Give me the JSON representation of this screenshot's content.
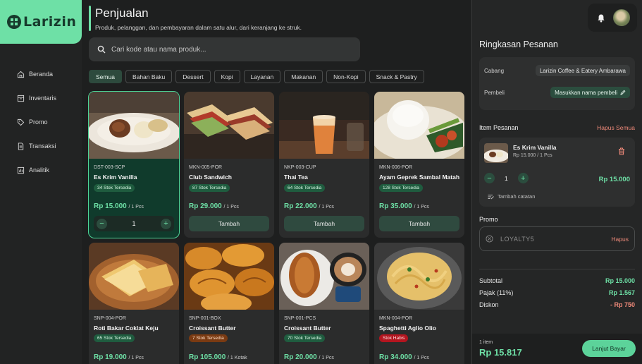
{
  "brand": {
    "name": "Larizin"
  },
  "sidebar": {
    "items": [
      {
        "label": "Beranda",
        "icon": "home-icon"
      },
      {
        "label": "Inventaris",
        "icon": "inventory-icon"
      },
      {
        "label": "Promo",
        "icon": "tag-icon"
      },
      {
        "label": "Transaksi",
        "icon": "receipt-icon"
      },
      {
        "label": "Analitik",
        "icon": "chart-icon"
      }
    ]
  },
  "header": {
    "title": "Penjualan",
    "subtitle": "Produk, pelanggan, dan pembayaran dalam satu alur, dari keranjang ke struk."
  },
  "search": {
    "placeholder": "Cari kode atau nama produk..."
  },
  "categories": [
    "Semua",
    "Bahan Baku",
    "Dessert",
    "Kopi",
    "Layanan",
    "Makanan",
    "Non-Kopi",
    "Snack & Pastry"
  ],
  "products": [
    {
      "code": "DST-003-SCP",
      "name": "Es Krim Vanilla",
      "stock": "34 Stok Tersedia",
      "stock_state": "ok",
      "price": "Rp 15.000",
      "unit": "/ 1 Pcs",
      "qty": "1",
      "selected": true,
      "img": "icecream"
    },
    {
      "code": "MKN-005-POR",
      "name": "Club Sandwich",
      "stock": "87 Stok Tersedia",
      "stock_state": "ok",
      "price": "Rp 29.000",
      "unit": "/ 1 Pcs",
      "button": "Tambah",
      "img": "sandwich"
    },
    {
      "code": "NKP-003-CUP",
      "name": "Thai Tea",
      "stock": "64 Stok Tersedia",
      "stock_state": "ok",
      "price": "Rp 22.000",
      "unit": "/ 1 Pcs",
      "button": "Tambah",
      "img": "thaitea"
    },
    {
      "code": "MKN-006-POR",
      "name": "Ayam Geprek Sambal Matah",
      "stock": "128 Stok Tersedia",
      "stock_state": "ok",
      "price": "Rp 35.000",
      "unit": "/ 1 Pcs",
      "button": "Tambah",
      "img": "rice"
    },
    {
      "code": "SNP-004-POR",
      "name": "Roti Bakar Coklat Keju",
      "stock": "65 Stok Tersedia",
      "stock_state": "ok",
      "price": "Rp 19.000",
      "unit": "/ 1 Pcs",
      "img": "toast"
    },
    {
      "code": "SNP-001-BOX",
      "name": "Croissant Butter",
      "stock": "7 Stok Tersedia",
      "stock_state": "low",
      "price": "Rp 105.000",
      "unit": "/ 1 Kotak",
      "img": "croissants"
    },
    {
      "code": "SNP-001-PCS",
      "name": "Croissant Butter",
      "stock": "70 Stok Tersedia",
      "stock_state": "ok",
      "price": "Rp 20.000",
      "unit": "/ 1 Pcs",
      "img": "croissantcoffee"
    },
    {
      "code": "MKN-004-POR",
      "name": "Spaghetti Aglio Olio",
      "stock": "Stok Habis",
      "stock_state": "out",
      "price": "Rp 34.000",
      "unit": "/ 1 Pcs",
      "img": "spaghetti"
    }
  ],
  "summary": {
    "title": "Ringkasan Pesanan",
    "branch_label": "Cabang",
    "branch_value": "Larizin Coffee & Eatery Ambarawa",
    "buyer_label": "Pembeli",
    "buyer_button": "Masukkan nama pembeli",
    "items_title": "Item Pesanan",
    "clear_all": "Hapus Semua",
    "item": {
      "name": "Es Krim Vanilla",
      "sub": "Rp 15.000 / 1 Pcs",
      "qty": "1",
      "price": "Rp 15.000",
      "note": "Tambah catatan"
    },
    "promo_title": "Promo",
    "promo_code": "LOYALTY5",
    "promo_remove": "Hapus",
    "subtotal_label": "Subtotal",
    "subtotal_value": "Rp 15.000",
    "tax_label": "Pajak (11%)",
    "tax_value": "Rp 1.567",
    "discount_label": "Diskon",
    "discount_value": "- Rp 750",
    "count": "1 item",
    "total": "Rp 15.817",
    "pay_button": "Lanjut Bayar"
  },
  "colors": {
    "accent": "#6ee0a6",
    "danger": "#f08a7a",
    "panel": "#252626"
  }
}
